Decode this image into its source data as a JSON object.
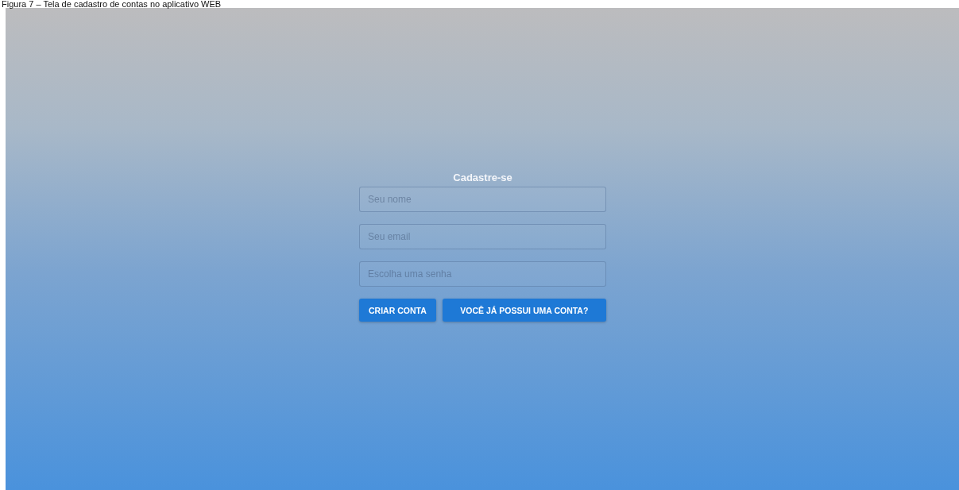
{
  "caption": "Figura 7 – Tela de cadastro de contas no aplicativo WEB",
  "form": {
    "title": "Cadastre-se",
    "fields": [
      {
        "placeholder": "Seu nome"
      },
      {
        "placeholder": "Seu email"
      },
      {
        "placeholder": "Escolha uma senha"
      }
    ],
    "buttons": [
      "CRIAR CONTA",
      "VOCÊ JÁ POSSUI UMA CONTA?"
    ]
  }
}
